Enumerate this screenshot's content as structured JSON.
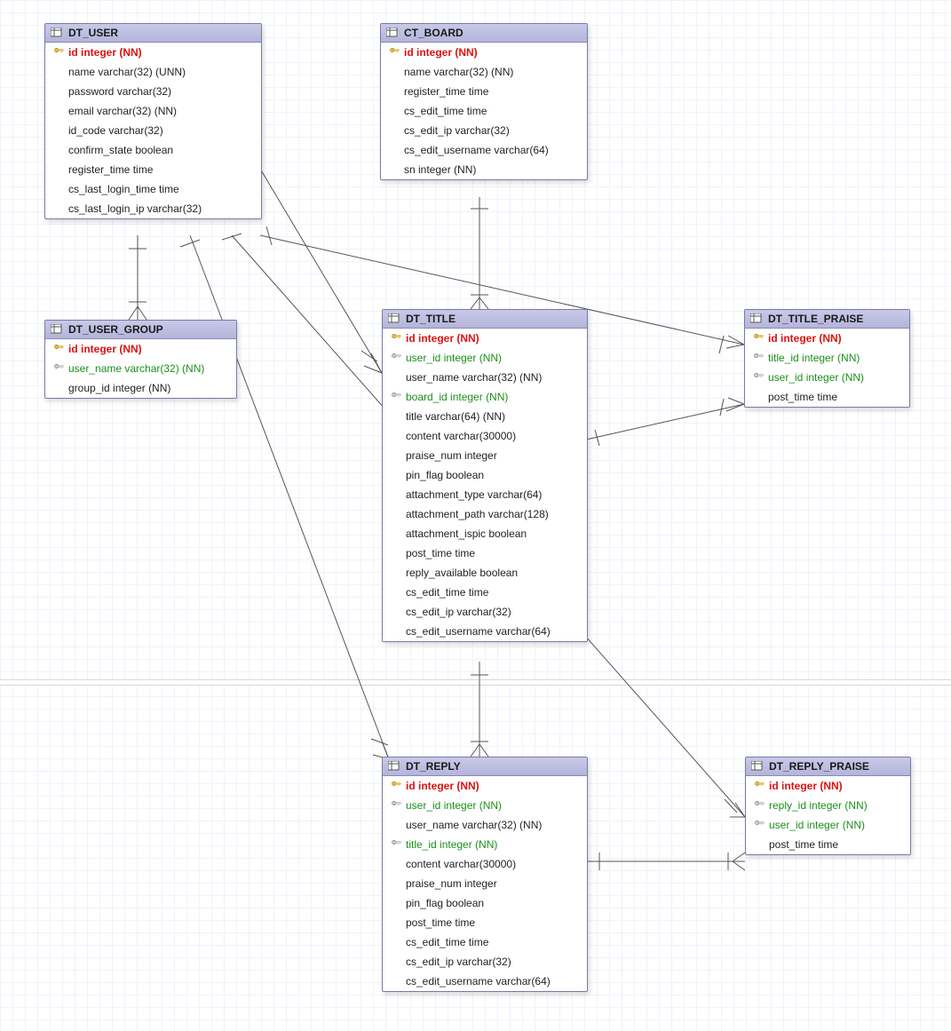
{
  "entities": {
    "user": {
      "title": "DT_USER",
      "cols": [
        {
          "kind": "pk",
          "text": "id integer (NN)"
        },
        {
          "kind": "col",
          "text": "name varchar(32) (UNN)"
        },
        {
          "kind": "col",
          "text": "password varchar(32)"
        },
        {
          "kind": "col",
          "text": "email varchar(32) (NN)"
        },
        {
          "kind": "col",
          "text": "id_code varchar(32)"
        },
        {
          "kind": "col",
          "text": "confirm_state boolean"
        },
        {
          "kind": "col",
          "text": "register_time time"
        },
        {
          "kind": "col",
          "text": "cs_last_login_time time"
        },
        {
          "kind": "col",
          "text": "cs_last_login_ip varchar(32)"
        }
      ]
    },
    "board": {
      "title": "CT_BOARD",
      "cols": [
        {
          "kind": "pk",
          "text": "id integer (NN)"
        },
        {
          "kind": "col",
          "text": "name varchar(32) (NN)"
        },
        {
          "kind": "col",
          "text": "register_time time"
        },
        {
          "kind": "col",
          "text": "cs_edit_time time"
        },
        {
          "kind": "col",
          "text": "cs_edit_ip varchar(32)"
        },
        {
          "kind": "col",
          "text": "cs_edit_username varchar(64)"
        },
        {
          "kind": "col",
          "text": "sn integer (NN)"
        }
      ]
    },
    "usergroup": {
      "title": "DT_USER_GROUP",
      "cols": [
        {
          "kind": "pk",
          "text": "id integer (NN)"
        },
        {
          "kind": "fk",
          "text": "user_name varchar(32) (NN)"
        },
        {
          "kind": "col",
          "text": "group_id integer (NN)"
        }
      ]
    },
    "title": {
      "title": "DT_TITLE",
      "cols": [
        {
          "kind": "pk",
          "text": "id integer (NN)"
        },
        {
          "kind": "fk",
          "text": "user_id integer (NN)"
        },
        {
          "kind": "col",
          "text": "user_name varchar(32) (NN)"
        },
        {
          "kind": "fk",
          "text": "board_id integer (NN)"
        },
        {
          "kind": "col",
          "text": "title varchar(64) (NN)"
        },
        {
          "kind": "col",
          "text": "content varchar(30000)"
        },
        {
          "kind": "col",
          "text": "praise_num integer"
        },
        {
          "kind": "col",
          "text": "pin_flag boolean"
        },
        {
          "kind": "col",
          "text": "attachment_type varchar(64)"
        },
        {
          "kind": "col",
          "text": "attachment_path varchar(128)"
        },
        {
          "kind": "col",
          "text": "attachment_ispic boolean"
        },
        {
          "kind": "col",
          "text": "post_time time"
        },
        {
          "kind": "col",
          "text": "reply_available boolean"
        },
        {
          "kind": "col",
          "text": "cs_edit_time time"
        },
        {
          "kind": "col",
          "text": "cs_edit_ip varchar(32)"
        },
        {
          "kind": "col",
          "text": "cs_edit_username varchar(64)"
        }
      ]
    },
    "titlepraise": {
      "title": "DT_TITLE_PRAISE",
      "cols": [
        {
          "kind": "pk",
          "text": "id integer (NN)"
        },
        {
          "kind": "fk",
          "text": "title_id integer (NN)"
        },
        {
          "kind": "fk",
          "text": "user_id integer (NN)"
        },
        {
          "kind": "col",
          "text": "post_time time"
        }
      ]
    },
    "reply": {
      "title": "DT_REPLY",
      "cols": [
        {
          "kind": "pk",
          "text": "id integer (NN)"
        },
        {
          "kind": "fk",
          "text": "user_id integer (NN)"
        },
        {
          "kind": "col",
          "text": "user_name varchar(32) (NN)"
        },
        {
          "kind": "fk",
          "text": "title_id integer (NN)"
        },
        {
          "kind": "col",
          "text": "content varchar(30000)"
        },
        {
          "kind": "col",
          "text": "praise_num integer"
        },
        {
          "kind": "col",
          "text": "pin_flag boolean"
        },
        {
          "kind": "col",
          "text": "post_time time"
        },
        {
          "kind": "col",
          "text": "cs_edit_time time"
        },
        {
          "kind": "col",
          "text": "cs_edit_ip varchar(32)"
        },
        {
          "kind": "col",
          "text": "cs_edit_username varchar(64)"
        }
      ]
    },
    "replypraise": {
      "title": "DT_REPLY_PRAISE",
      "cols": [
        {
          "kind": "pk",
          "text": "id integer (NN)"
        },
        {
          "kind": "fk",
          "text": "reply_id integer (NN)"
        },
        {
          "kind": "fk",
          "text": "user_id integer (NN)"
        },
        {
          "kind": "col",
          "text": "post_time time"
        }
      ]
    }
  }
}
